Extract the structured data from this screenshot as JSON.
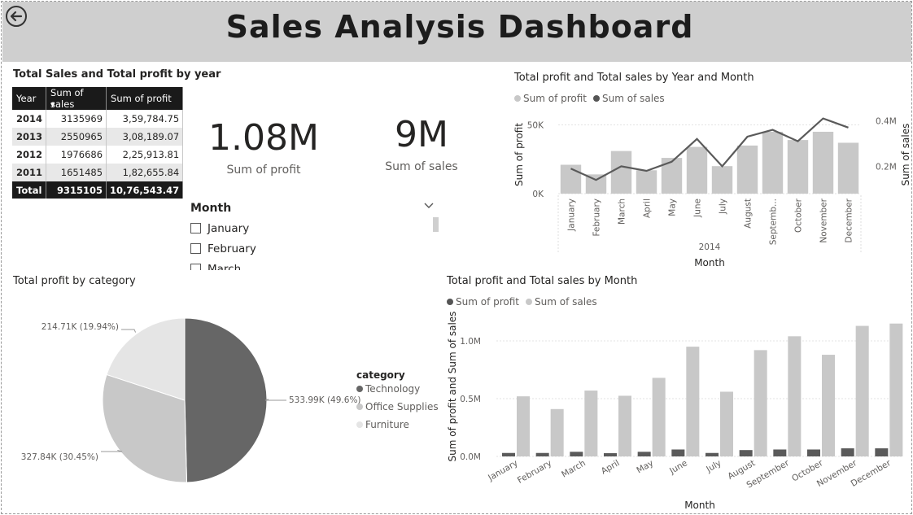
{
  "header": {
    "title": "Sales Analysis Dashboard",
    "back_icon": "back-arrow-icon"
  },
  "table_visual": {
    "title": "Total Sales and Total profit by year",
    "columns": [
      "Year",
      "Sum of sales",
      "Sum of profit"
    ],
    "rows": [
      {
        "year": "2014",
        "sales": "3135969",
        "profit": "3,59,784.75"
      },
      {
        "year": "2013",
        "sales": "2550965",
        "profit": "3,08,189.07"
      },
      {
        "year": "2012",
        "sales": "1976686",
        "profit": "2,25,913.81"
      },
      {
        "year": "2011",
        "sales": "1651485",
        "profit": "1,82,655.84"
      }
    ],
    "total": {
      "label": "Total",
      "sales": "9315105",
      "profit": "10,76,543.47"
    }
  },
  "cards": {
    "profit": {
      "value": "1.08M",
      "label": "Sum of profit"
    },
    "sales": {
      "value": "9M",
      "label": "Sum of sales"
    }
  },
  "slicer": {
    "title": "Month",
    "items": [
      "January",
      "February",
      "March"
    ]
  },
  "colors": {
    "dark": "#666666",
    "light": "#c8c8c8",
    "lighter": "#e5e5e5",
    "header_bg": "#cfcfcf"
  },
  "chart_data": [
    {
      "type": "bar",
      "id": "year_month",
      "title": "Total profit and Total sales by Year and Month",
      "legend": [
        "Sum of profit",
        "Sum of sales"
      ],
      "categories": [
        "January",
        "February",
        "March",
        "April",
        "May",
        "June",
        "July",
        "August",
        "Septemb...",
        "October",
        "November",
        "December"
      ],
      "year_label": "2014",
      "xlabel": "Month",
      "ylabel": "Sum of profit",
      "y2label": "Sum of sales",
      "yticks": [
        "0K",
        "50K"
      ],
      "y2ticks": [
        "0.2M",
        "0.4M"
      ],
      "ylim": [
        0,
        58000
      ],
      "y2lim": [
        80000,
        430000
      ],
      "series": [
        {
          "name": "Sum of profit",
          "kind": "bar",
          "values": [
            21000,
            14000,
            31000,
            17000,
            26000,
            34000,
            20000,
            35000,
            45000,
            39000,
            45000,
            37000
          ]
        },
        {
          "name": "Sum of sales",
          "kind": "line",
          "values": [
            190000,
            140000,
            200000,
            180000,
            220000,
            320000,
            200000,
            330000,
            360000,
            310000,
            410000,
            370000
          ]
        }
      ]
    },
    {
      "type": "pie",
      "id": "category",
      "title": "Total profit by category",
      "legend_title": "category",
      "slices": [
        {
          "name": "Technology",
          "value": 533990,
          "label": "533.99K (49.6%)"
        },
        {
          "name": "Office Supplies",
          "value": 327840,
          "label": "327.84K (30.45%)"
        },
        {
          "name": "Furniture",
          "value": 214710,
          "label": "214.71K (19.94%)"
        }
      ]
    },
    {
      "type": "bar",
      "id": "month",
      "title": "Total profit and Total sales by Month",
      "legend": [
        "Sum of profit",
        "Sum of sales"
      ],
      "categories": [
        "January",
        "February",
        "March",
        "April",
        "May",
        "June",
        "July",
        "August",
        "September",
        "October",
        "November",
        "December"
      ],
      "xlabel": "Month",
      "ylabel": "Sum of profit and Sum of sales",
      "yticks": [
        "0.0M",
        "0.5M",
        "1.0M"
      ],
      "ylim": [
        0,
        1250000
      ],
      "series": [
        {
          "name": "Sum of profit",
          "values": [
            30000,
            30000,
            40000,
            28000,
            40000,
            60000,
            30000,
            55000,
            60000,
            60000,
            70000,
            70000
          ]
        },
        {
          "name": "Sum of sales",
          "values": [
            520000,
            410000,
            570000,
            525000,
            680000,
            950000,
            560000,
            920000,
            1040000,
            880000,
            1130000,
            1150000
          ]
        }
      ]
    }
  ]
}
